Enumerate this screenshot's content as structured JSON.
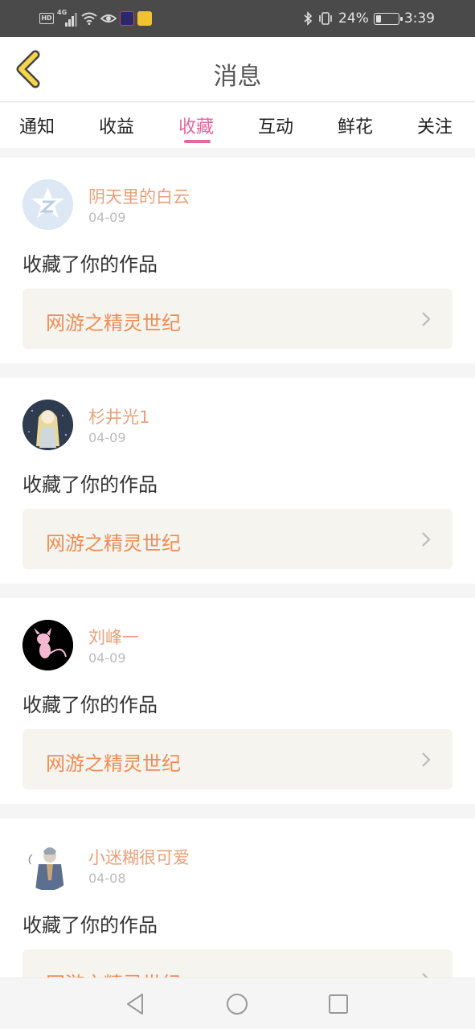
{
  "status_bar": {
    "hd_label": "HD",
    "network_label": "4G",
    "battery_text": "24%",
    "battery_level": 0.24,
    "time": "3:39"
  },
  "header": {
    "title": "消息",
    "back_icon": "chevron-left-icon"
  },
  "tabs": [
    {
      "label": "通知",
      "active": false
    },
    {
      "label": "收益",
      "active": false
    },
    {
      "label": "收藏",
      "active": true
    },
    {
      "label": "互动",
      "active": false
    },
    {
      "label": "鲜花",
      "active": false
    },
    {
      "label": "关注",
      "active": false
    }
  ],
  "messages": [
    {
      "user": "阴天里的白云",
      "date": "04-09",
      "action": "收藏了你的作品",
      "work": "网游之精灵世纪"
    },
    {
      "user": "杉井光1",
      "date": "04-09",
      "action": "收藏了你的作品",
      "work": "网游之精灵世纪"
    },
    {
      "user": "刘峰一",
      "date": "04-09",
      "action": "收藏了你的作品",
      "work": "网游之精灵世纪"
    },
    {
      "user": "小迷糊很可爱",
      "date": "04-08",
      "action": "收藏了你的作品",
      "work": "网游之精灵世纪"
    }
  ],
  "colors": {
    "accent": "#e667a0",
    "username": "#e9a07a",
    "work_title": "#f08c54",
    "work_bg": "#f5f4ee"
  },
  "nav_bar": {
    "icons": [
      "back-triangle-icon",
      "home-circle-icon",
      "recents-square-icon"
    ]
  }
}
